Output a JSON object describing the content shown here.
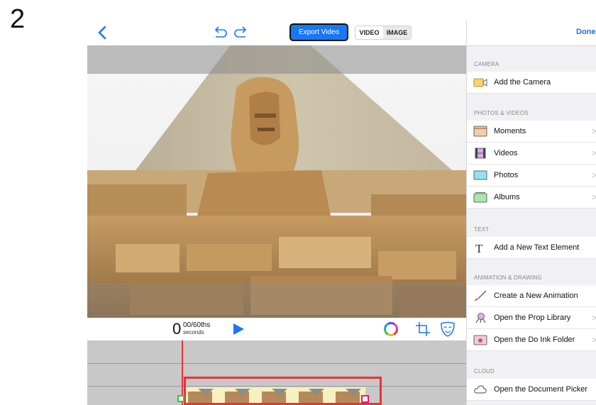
{
  "step_number": "2",
  "toolbar": {
    "export_label": "Export Video",
    "mode_video": "VIDEO",
    "mode_image": "IMAGE",
    "active_mode": "VIDEO",
    "icons": [
      "back-chevron-icon",
      "undo-icon",
      "redo-icon"
    ]
  },
  "playback": {
    "time_main": "0",
    "time_fraction": "00/60ths",
    "time_unit": "seconds",
    "icons": [
      "play-icon",
      "color-wheel-icon",
      "crop-icon",
      "mask-icon"
    ]
  },
  "panel": {
    "done_label": "Done",
    "sections": [
      {
        "title": "CAMERA",
        "items": [
          {
            "label": "Add the Camera",
            "icon": "camera-icon",
            "chevron": false
          }
        ]
      },
      {
        "title": "PHOTOS & VIDEOS",
        "items": [
          {
            "label": "Moments",
            "icon": "moments-icon",
            "chevron": true
          },
          {
            "label": "Videos",
            "icon": "film-icon",
            "chevron": true
          },
          {
            "label": "Photos",
            "icon": "photos-icon",
            "chevron": true
          },
          {
            "label": "Albums",
            "icon": "albums-icon",
            "chevron": true
          }
        ]
      },
      {
        "title": "TEXT",
        "items": [
          {
            "label": "Add a New Text Element",
            "icon": "text-icon",
            "chevron": false
          }
        ]
      },
      {
        "title": "ANIMATION & DRAWING",
        "items": [
          {
            "label": "Create a New Animation",
            "icon": "brush-icon",
            "chevron": false
          },
          {
            "label": "Open the Prop Library",
            "icon": "prop-icon",
            "chevron": true
          },
          {
            "label": "Open the Do Ink Folder",
            "icon": "folder-icon",
            "chevron": true
          }
        ]
      },
      {
        "title": "CLOUD",
        "items": [
          {
            "label": "Open the Document Picker",
            "icon": "cloud-icon",
            "chevron": false
          }
        ]
      }
    ]
  },
  "colors": {
    "accent_blue": "#1877f2",
    "playhead_red": "#e8323c",
    "handle_green": "#3cbf3c",
    "handle_pink": "#e3197a"
  }
}
